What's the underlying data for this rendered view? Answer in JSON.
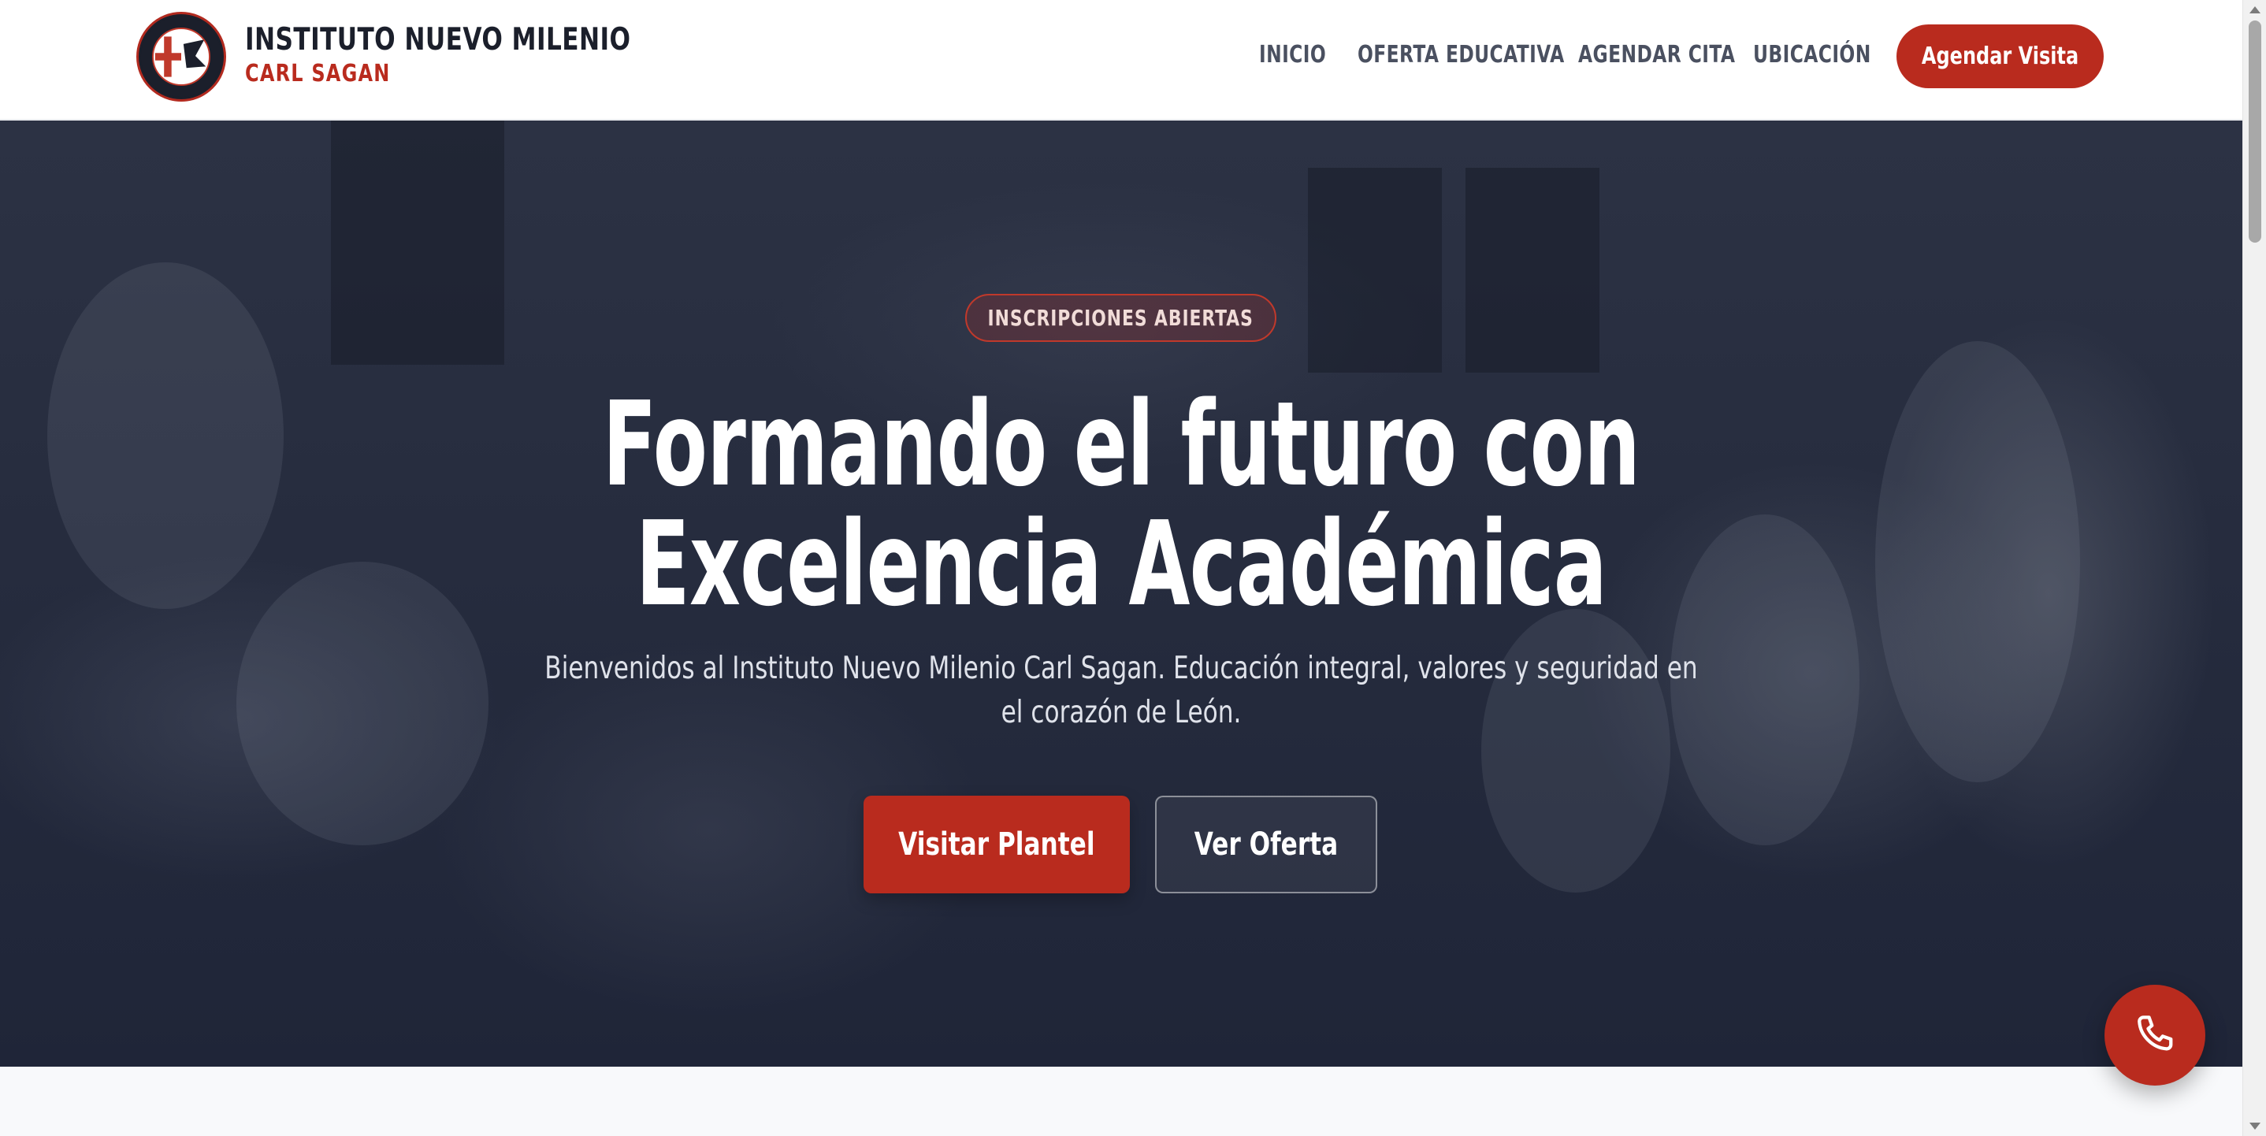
{
  "header": {
    "brand_name": "INSTITUTO NUEVO MILENIO",
    "brand_sub": "CARL SAGAN",
    "logo_text_top": "INSTITUTO NUEVO MILENIO",
    "logo_text_bottom": "CARL SAGAN",
    "nav": [
      {
        "label": "INICIO"
      },
      {
        "label": "OFERTA EDUCATIVA"
      },
      {
        "label": "AGENDAR CITA"
      },
      {
        "label": "UBICACIÓN"
      }
    ],
    "cta_label": "Agendar Visita"
  },
  "hero": {
    "badge": "INSCRIPCIONES ABIERTAS",
    "title_line1": "Formando el futuro con",
    "title_line2": "Excelencia Académica",
    "subtitle_line1": "Bienvenidos al Instituto Nuevo Milenio Carl Sagan. Educación integral, valores y seguridad en",
    "subtitle_line2": "el corazón de León.",
    "primary_button": "Visitar Plantel",
    "secondary_button": "Ver Oferta"
  },
  "floating": {
    "icon": "phone-icon"
  },
  "colors": {
    "accent": "#b92b1e",
    "dark": "#1b1f2b",
    "nav_text": "#4a5060",
    "hero_overlay": "#262c3e"
  }
}
